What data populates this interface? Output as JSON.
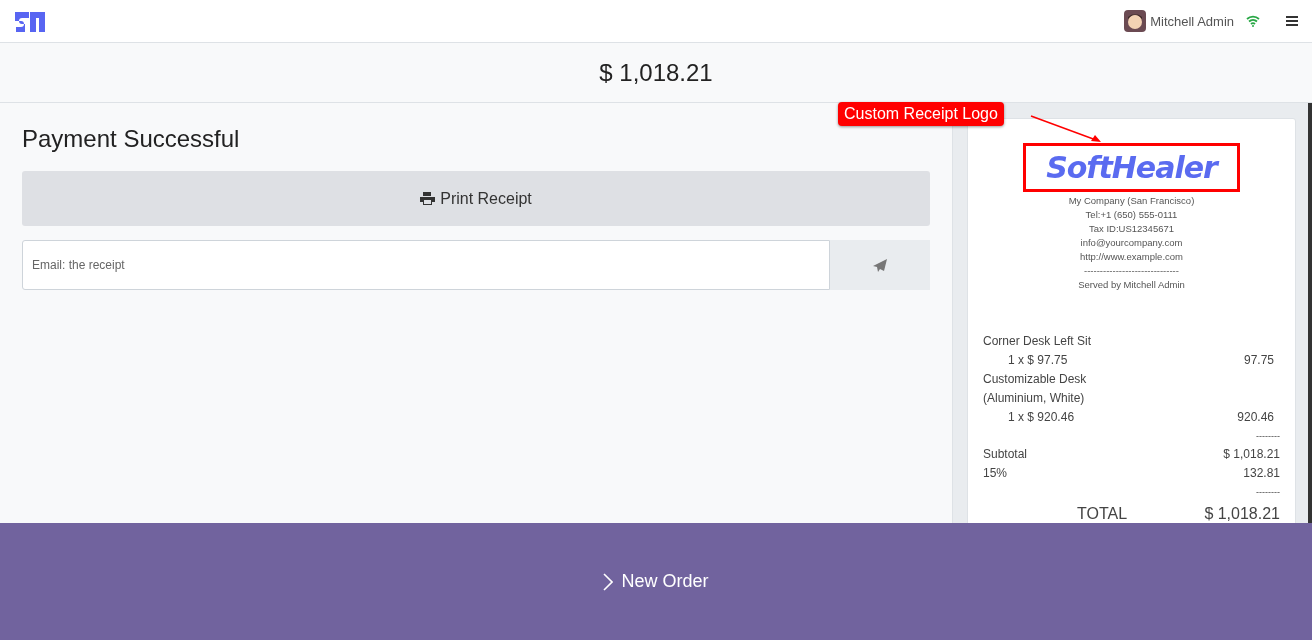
{
  "header": {
    "user": "Mitchell Admin"
  },
  "amount_due": "$ 1,018.21",
  "status_title": "Payment Successful",
  "print_button": "Print Receipt",
  "email_field": {
    "placeholder": "Email: the receipt"
  },
  "receipt": {
    "logo": "SoftHealer",
    "company_lines": [
      "My Company (San Francisco)",
      "Tel:+1 (650) 555-0111",
      "Tax ID:US12345671",
      "info@yourcompany.com",
      "http://www.example.com",
      "------------------------------",
      "Served by Mitchell Admin"
    ],
    "lines": [
      {
        "kind": "name",
        "label": "Corner Desk Left Sit"
      },
      {
        "kind": "qty",
        "label": "1 x $ 97.75",
        "amount": "97.75"
      },
      {
        "kind": "name",
        "label": "Customizable Desk"
      },
      {
        "kind": "name",
        "label": "(Aluminium, White)"
      },
      {
        "kind": "qty",
        "label": "1 x $ 920.46",
        "amount": "920.46"
      },
      {
        "kind": "rule",
        "amount": "--------"
      },
      {
        "kind": "sum",
        "label": "Subtotal",
        "amount": "$ 1,018.21"
      },
      {
        "kind": "sum",
        "label": "15%",
        "amount": "132.81"
      },
      {
        "kind": "rule",
        "amount": "--------"
      },
      {
        "kind": "total",
        "label": "TOTAL",
        "amount": "$ 1,018.21"
      }
    ]
  },
  "annotation": "Custom Receipt Logo",
  "new_order_button": "New Order"
}
